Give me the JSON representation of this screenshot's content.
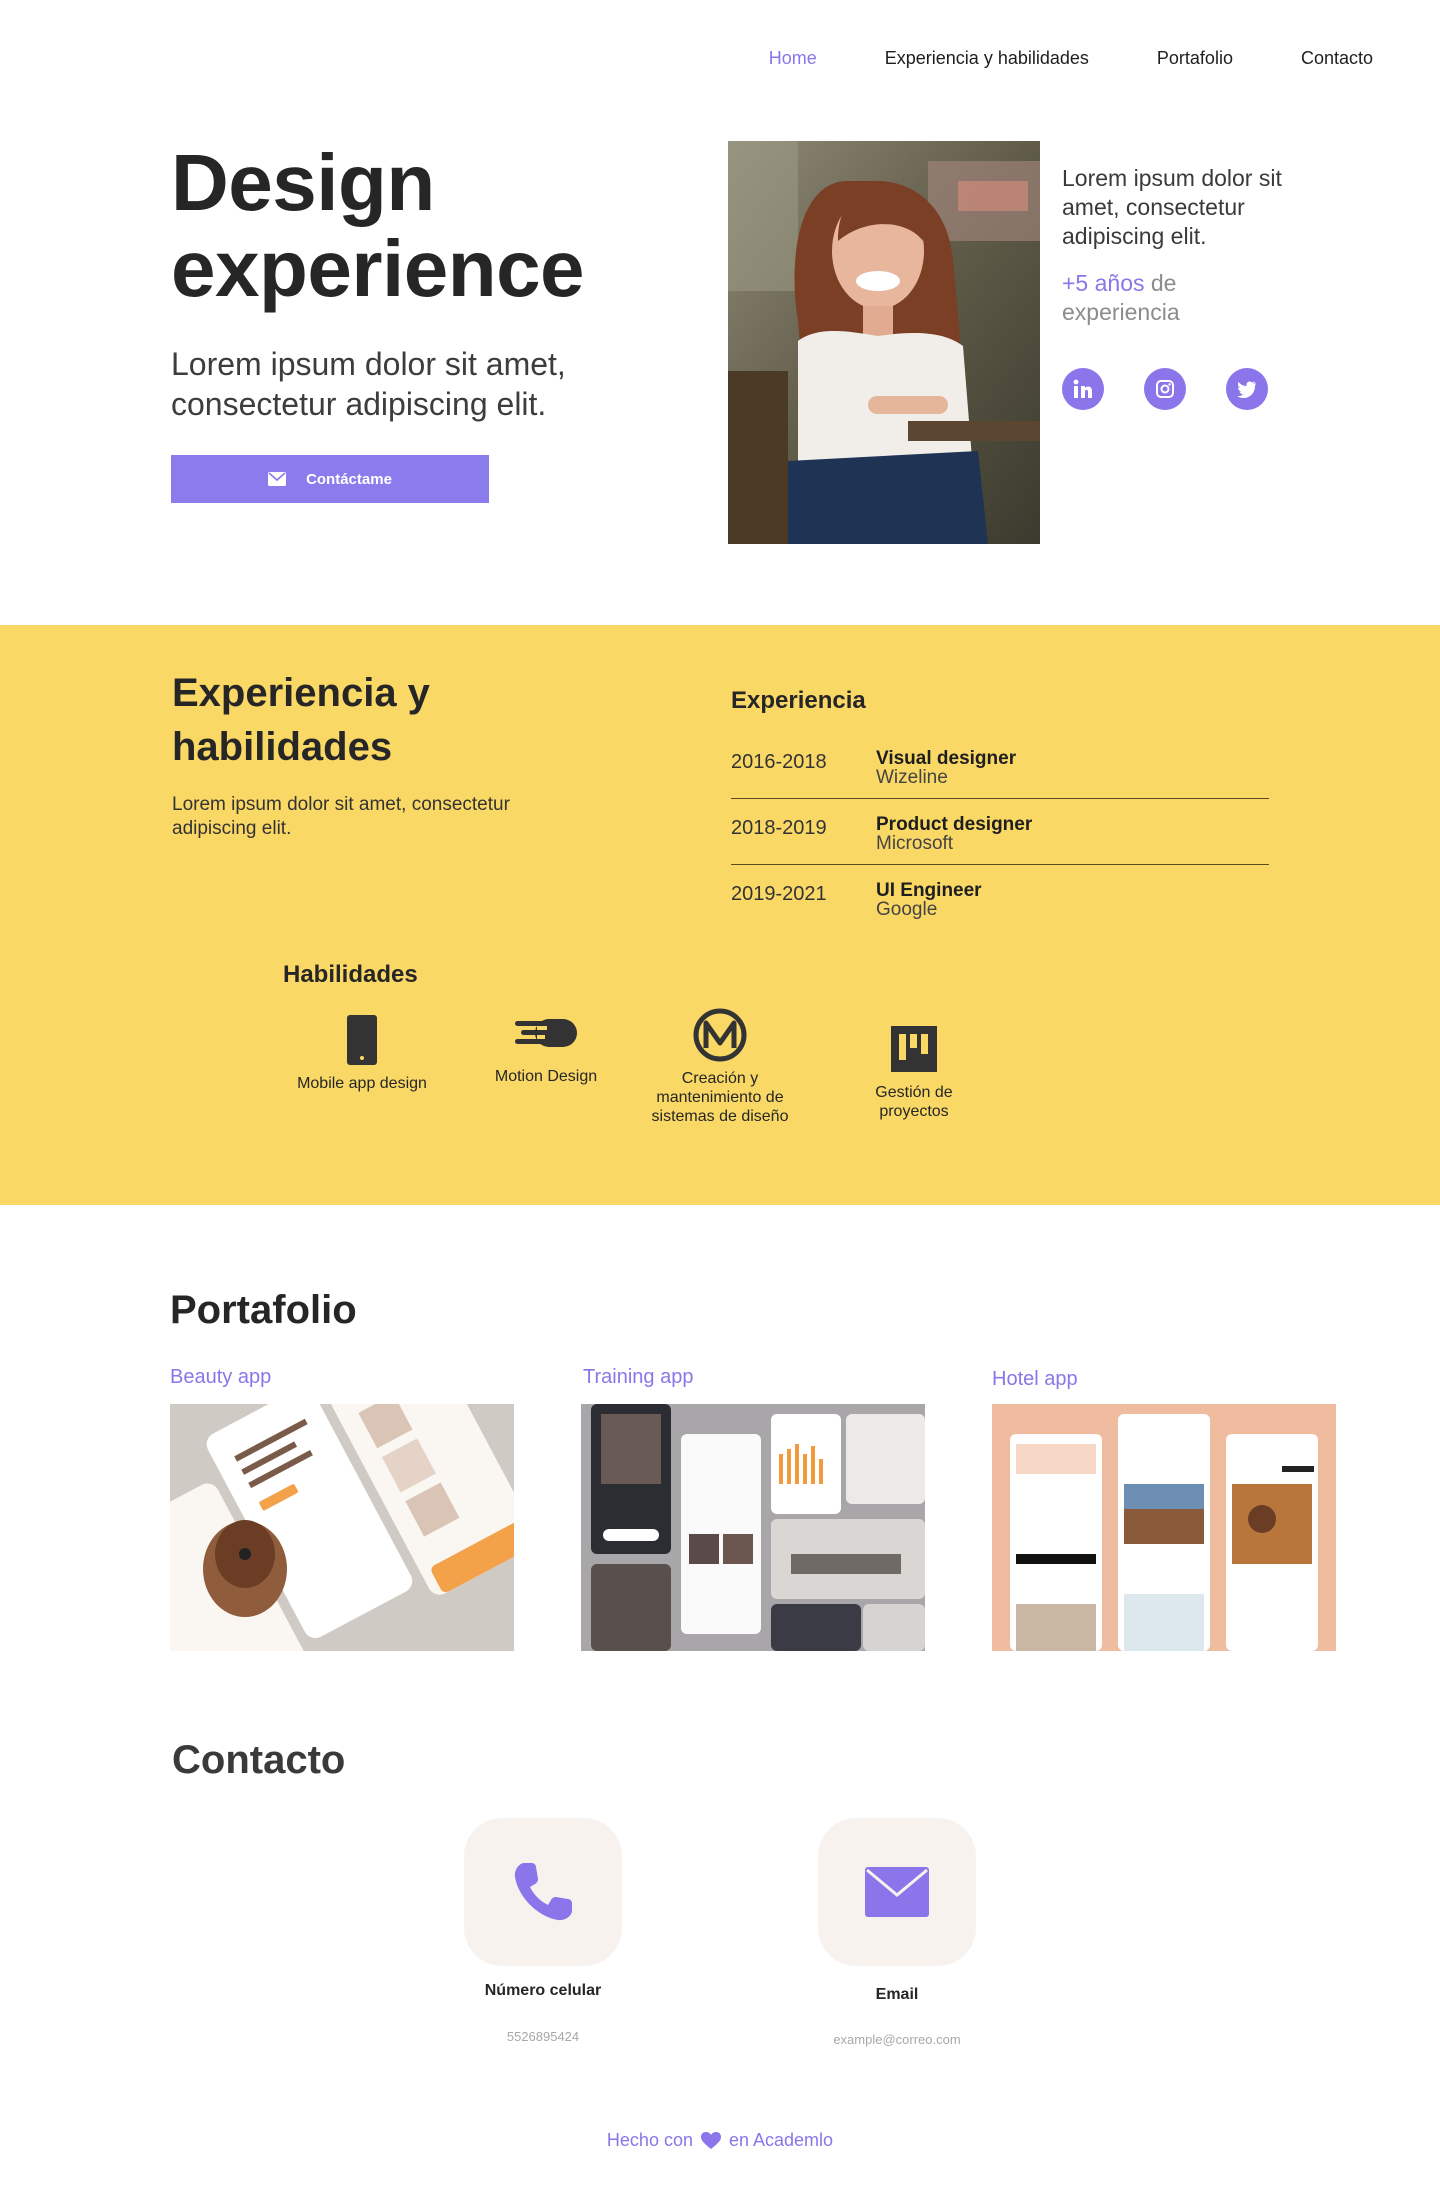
{
  "nav": {
    "items": [
      {
        "label": "Home",
        "active": true
      },
      {
        "label": "Experiencia y habilidades",
        "active": false
      },
      {
        "label": "Portafolio",
        "active": false
      },
      {
        "label": "Contacto",
        "active": false
      }
    ]
  },
  "hero": {
    "title_line1": "Design",
    "title_line2": "experience",
    "subtitle": "Lorem ipsum dolor sit amet, consectetur adipiscing elit.",
    "cta_label": "Contáctame",
    "intro": "Lorem ipsum dolor sit amet, consectetur adipiscing elit.",
    "years_accent": "+5 años",
    "years_rest": " de experiencia",
    "socials": [
      "linkedin-icon",
      "instagram-icon",
      "twitter-icon"
    ]
  },
  "experience": {
    "title": "Experiencia y habilidades",
    "description": "Lorem ipsum dolor sit amet, consectetur adipiscing elit.",
    "list_title": "Experiencia",
    "jobs": [
      {
        "years": "2016-2018",
        "role": "Visual designer",
        "company": "Wizeline"
      },
      {
        "years": "2018-2019",
        "role": "Product designer",
        "company": "Microsoft"
      },
      {
        "years": "2019-2021",
        "role": "UI Engineer",
        "company": "Google"
      }
    ],
    "skills_title": "Habilidades",
    "skills": [
      {
        "label": "Mobile app design",
        "icon": "mobile-icon"
      },
      {
        "label": "Motion Design",
        "icon": "motion-icon"
      },
      {
        "label": "Creación y mantenimiento de sistemas de diseño",
        "icon": "design-system-icon"
      },
      {
        "label": "Gestión de proyectos",
        "icon": "project-board-icon"
      }
    ]
  },
  "portfolio": {
    "title": "Portafolio",
    "items": [
      {
        "label": "Beauty app"
      },
      {
        "label": "Training app"
      },
      {
        "label": "Hotel app"
      }
    ]
  },
  "contact": {
    "title": "Contacto",
    "phone_label": "Número celular",
    "phone_value": "5526895424",
    "email_label": "Email",
    "email_value": "example@correo.com"
  },
  "footer": {
    "before": "Hecho con",
    "after": "en Academlo"
  },
  "colors": {
    "accent": "#8a75ea",
    "yellow": "#fad865",
    "tile": "#f8f2ef"
  }
}
